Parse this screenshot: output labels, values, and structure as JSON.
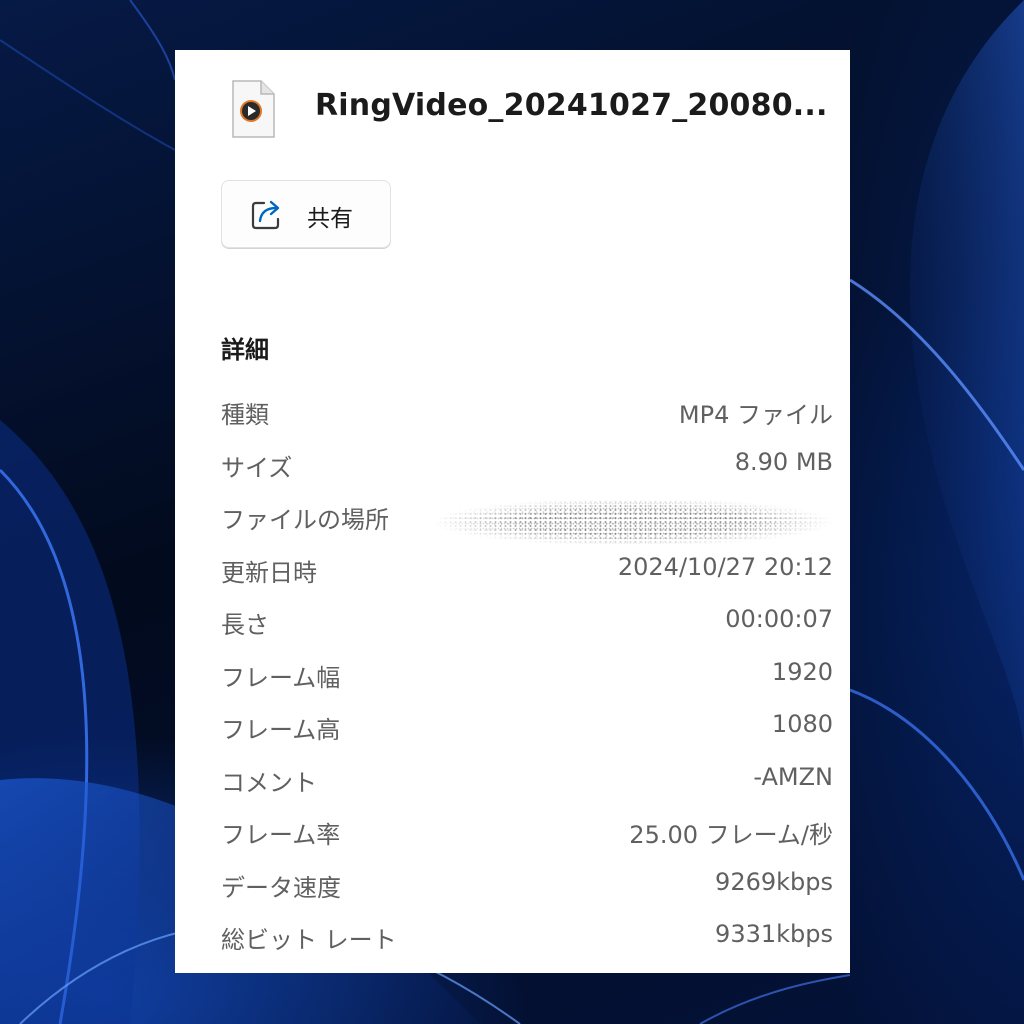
{
  "file": {
    "name": "RingVideo_20241027_20080...",
    "icon": "video-file-icon"
  },
  "share": {
    "label": "共有",
    "icon": "share-icon"
  },
  "details": {
    "title": "詳細",
    "rows": [
      {
        "label": "種類",
        "value": "MP4 ファイル"
      },
      {
        "label": "サイズ",
        "value": "8.90 MB"
      },
      {
        "label": "ファイルの場所",
        "value": ""
      },
      {
        "label": "更新日時",
        "value": "2024/10/27 20:12"
      },
      {
        "label": "長さ",
        "value": "00:00:07"
      },
      {
        "label": "フレーム幅",
        "value": "1920"
      },
      {
        "label": "フレーム高",
        "value": "1080"
      },
      {
        "label": "コメント",
        "value": "-AMZN"
      },
      {
        "label": "フレーム率",
        "value": "25.00 フレーム/秒"
      },
      {
        "label": "データ速度",
        "value": "9269kbps"
      },
      {
        "label": "総ビット レート",
        "value": "9331kbps"
      }
    ]
  },
  "colors": {
    "panel_bg": "#ffffff",
    "accent": "#0067c0",
    "label_text": "#606060",
    "title_text": "#1b1b1b"
  }
}
